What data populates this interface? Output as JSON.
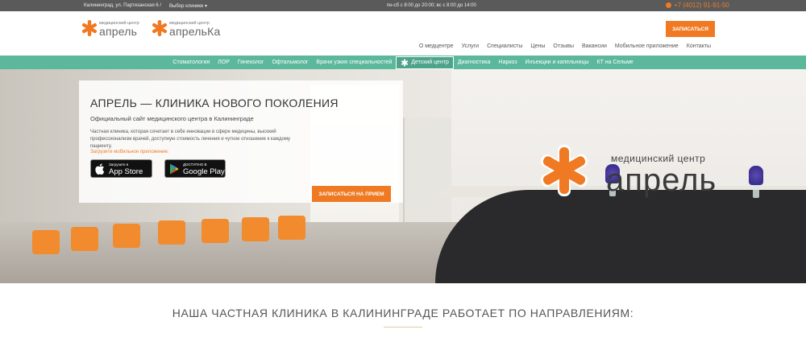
{
  "topbar": {
    "address": "Калининград, ул. Партизанская 6 /",
    "clinic_select": "Выбор клиники",
    "clinic_select_arrow": "▾",
    "hours": "пн-сб с 8:00 до 20:00; вс с 8:00 до 14:00",
    "phone": "+7 (4012) 91-91-50"
  },
  "logos": [
    {
      "small": "медицинский центр",
      "big": "апрель"
    },
    {
      "small": "медицинский центр",
      "big": "апрельКа"
    }
  ],
  "header": {
    "cta_label": "ЗАПИСАТЬСЯ",
    "nav": [
      "О медцентре",
      "Услуги",
      "Специалисты",
      "Цены",
      "Отзывы",
      "Вакансии",
      "Мобильное приложение",
      "Контакты"
    ]
  },
  "services": {
    "items_before": [
      "Стоматология",
      "ЛОР",
      "Гинеколог",
      "Офтальмолог",
      "Врачи узких специальностей"
    ],
    "kids": "Детский центр",
    "items_after": [
      "Диагностика",
      "Наркоз",
      "Инъекции и капельницы",
      "КТ на Сельме"
    ]
  },
  "hero": {
    "title": "АПРЕЛЬ — КЛИНИКА НОВОГО ПОКОЛЕНИЯ",
    "subtitle": "Официальный сайт медицинского центра в Калининграде",
    "description": "Частная клиника, которая сочетает в себе инновации в сфере медицины, высокий профессионализм врачей, доступную стоимость лечения и чуткое отношение к каждому пациенту.",
    "app_prompt": "Загрузите мобильное приложение:",
    "appstore_small": "Загрузите в",
    "appstore_big": "App Store",
    "gplay_small": "ДОСТУПНО В",
    "gplay_big": "Google Play",
    "cta_label": "ЗАПИСАТЬСЯ НА ПРИЕМ",
    "wall_logo_small": "медицинский центр",
    "wall_logo_big": "апрель"
  },
  "directions_title": "НАША ЧАСТНАЯ КЛИНИКА В КАЛИНИНГРАДЕ РАБОТАЕТ ПО НАПРАВЛЕНИЯМ:",
  "colors": {
    "accent": "#f07a23",
    "service_bar": "#5cb89b",
    "topbar": "#5a5a5a"
  }
}
